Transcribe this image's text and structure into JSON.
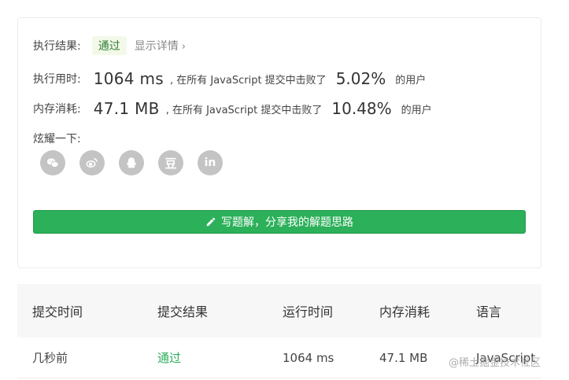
{
  "result": {
    "label": "执行结果:",
    "status": "通过",
    "details_link": "显示详情",
    "details_chevron": "›"
  },
  "runtime": {
    "label": "执行用时:",
    "value": "1064 ms",
    "text": ", 在所有 JavaScript 提交中击败了",
    "percent": "5.02%",
    "suffix": "的用户"
  },
  "memory": {
    "label": "内存消耗:",
    "value": "47.1 MB",
    "text": ", 在所有 JavaScript 提交中击败了",
    "percent": "10.48%",
    "suffix": "的用户"
  },
  "share": {
    "label": "炫耀一下:",
    "icons": [
      "wechat-icon",
      "weibo-icon",
      "qq-icon",
      "douban-icon",
      "linkedin-icon"
    ],
    "douban_glyph": "豆",
    "linkedin_glyph": "in"
  },
  "write_button": {
    "label": "写题解，分享我的解题思路",
    "icon": "pencil-icon"
  },
  "table": {
    "headers": [
      "提交时间",
      "提交结果",
      "运行时间",
      "内存消耗",
      "语言"
    ],
    "rows": [
      [
        "几秒前",
        "通过",
        "1064 ms",
        "47.1 MB",
        "JavaScript"
      ]
    ]
  },
  "watermark": "@稀土掘金技术社区",
  "colors": {
    "accent_green": "#2cb05a",
    "icon_gray": "#c4c4c4"
  }
}
